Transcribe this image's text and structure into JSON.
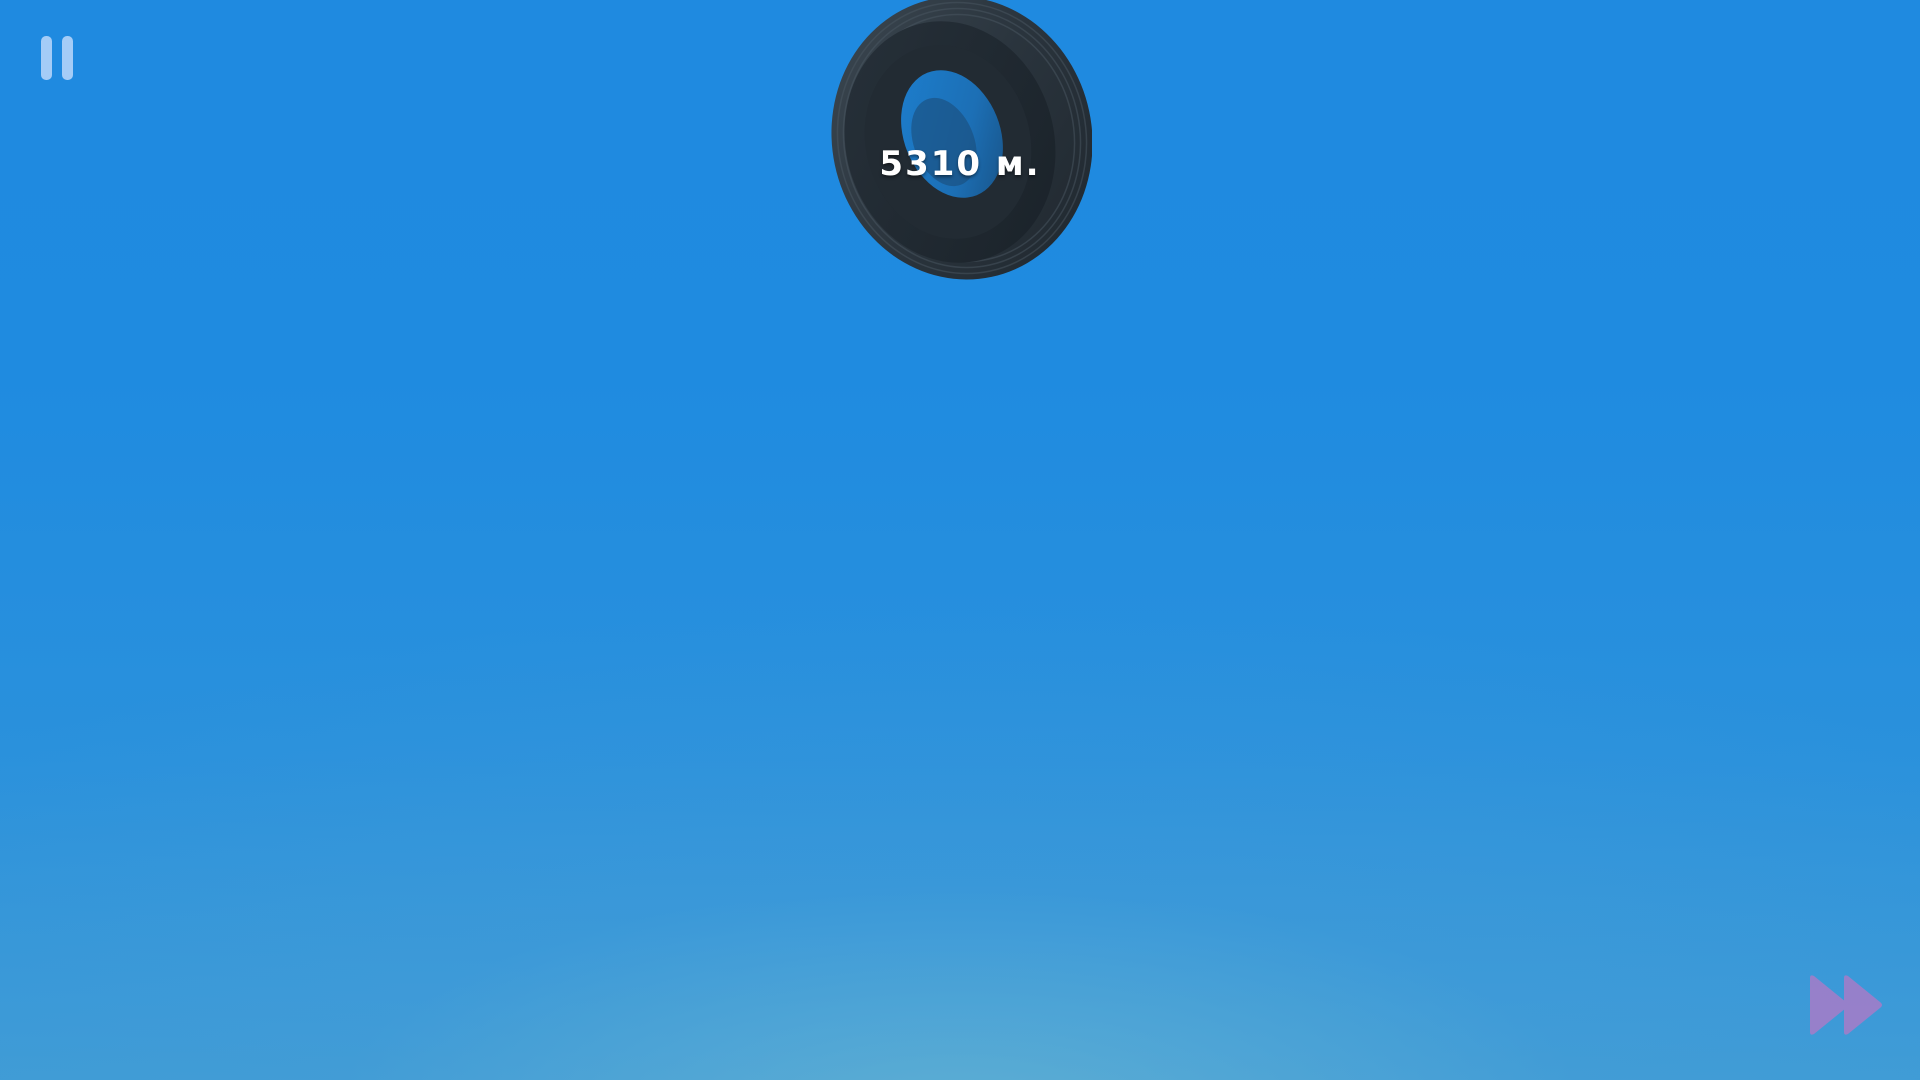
{
  "hud": {
    "distance_text": "5310 м.",
    "pause_icon": "pause-icon",
    "fast_forward_icon": "fast-forward-icon"
  },
  "object": {
    "name": "tire"
  },
  "colors": {
    "sky_top": "#1f8ae0",
    "sky_bottom": "#3d9bd6",
    "pause": "#d2e1ff",
    "fast_forward": "#a77cc8",
    "tire": "#2b3640"
  }
}
